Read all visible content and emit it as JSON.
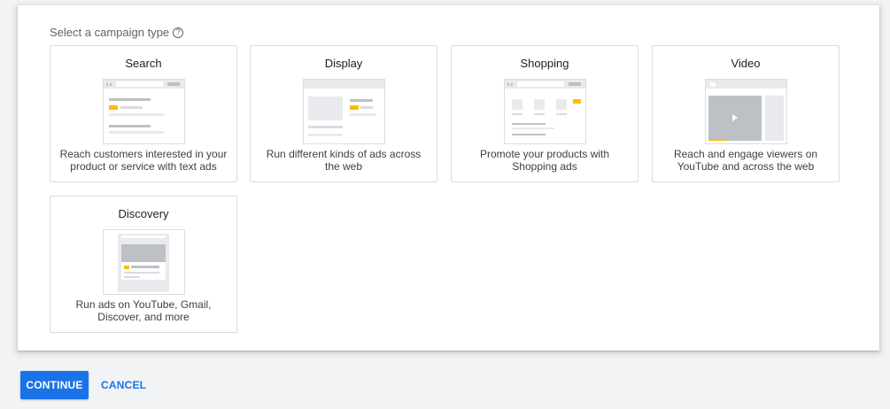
{
  "heading": {
    "label": "Select a campaign type",
    "help_icon": "?"
  },
  "campaign_types": [
    {
      "title": "Search",
      "description": "Reach customers interested in your product or service with text ads"
    },
    {
      "title": "Display",
      "description": "Run different kinds of ads across the web"
    },
    {
      "title": "Shopping",
      "description": "Promote your products with Shopping ads"
    },
    {
      "title": "Video",
      "description": "Reach and engage viewers on YouTube and across the web"
    },
    {
      "title": "Discovery",
      "description": "Run ads on YouTube, Gmail, Discover, and more"
    }
  ],
  "actions": {
    "continue_label": "CONTINUE",
    "cancel_label": "CANCEL"
  },
  "colors": {
    "accent": "#1a73e8",
    "highlight": "#fbbc04",
    "background": "#f1f3f4"
  }
}
